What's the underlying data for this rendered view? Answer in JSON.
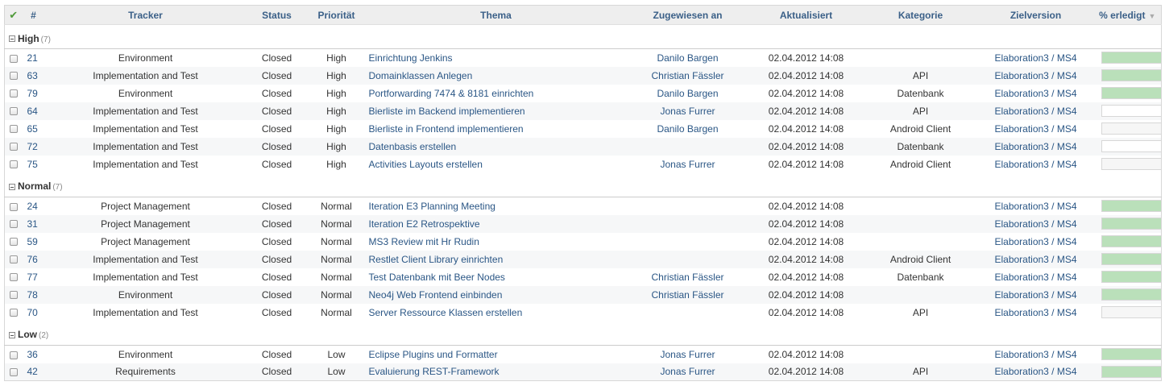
{
  "columns": {
    "id": "#",
    "tracker": "Tracker",
    "status": "Status",
    "priority": "Priorität",
    "subject": "Thema",
    "assigned": "Zugewiesen an",
    "updated": "Aktualisiert",
    "category": "Kategorie",
    "version": "Zielversion",
    "done": "% erledigt"
  },
  "icons": {
    "check_all": "checkmark-icon",
    "sort": "sort-desc-icon",
    "group_toggle": "collapse-icon"
  },
  "colors": {
    "link": "#2a5685",
    "header_bg": "#eeeeee",
    "row_alt": "#f6f7f8",
    "progress_fill": "#bae0ba"
  },
  "groups": [
    {
      "name": "High",
      "count": "(7)",
      "rows": [
        {
          "id": "21",
          "tracker": "Environment",
          "status": "Closed",
          "priority": "High",
          "subject": "Einrichtung Jenkins",
          "assigned": "Danilo Bargen",
          "updated": "02.04.2012 14:08",
          "category": "",
          "version": "Elaboration3 / MS4",
          "done": 1.0
        },
        {
          "id": "63",
          "tracker": "Implementation and Test",
          "status": "Closed",
          "priority": "High",
          "subject": "Domainklassen Anlegen",
          "assigned": "Christian Fässler",
          "updated": "02.04.2012 14:08",
          "category": "API",
          "version": "Elaboration3 / MS4",
          "done": 1.0
        },
        {
          "id": "79",
          "tracker": "Environment",
          "status": "Closed",
          "priority": "High",
          "subject": "Portforwarding 7474 & 8181 einrichten",
          "assigned": "Danilo Bargen",
          "updated": "02.04.2012 14:08",
          "category": "Datenbank",
          "version": "Elaboration3 / MS4",
          "done": 1.0
        },
        {
          "id": "64",
          "tracker": "Implementation and Test",
          "status": "Closed",
          "priority": "High",
          "subject": "Bierliste im Backend implementieren",
          "assigned": "Jonas Furrer",
          "updated": "02.04.2012 14:08",
          "category": "API",
          "version": "Elaboration3 / MS4",
          "done": 0.0
        },
        {
          "id": "65",
          "tracker": "Implementation and Test",
          "status": "Closed",
          "priority": "High",
          "subject": "Bierliste in Frontend implementieren",
          "assigned": "Danilo Bargen",
          "updated": "02.04.2012 14:08",
          "category": "Android Client",
          "version": "Elaboration3 / MS4",
          "done": 0.0
        },
        {
          "id": "72",
          "tracker": "Implementation and Test",
          "status": "Closed",
          "priority": "High",
          "subject": "Datenbasis erstellen",
          "assigned": "",
          "updated": "02.04.2012 14:08",
          "category": "Datenbank",
          "version": "Elaboration3 / MS4",
          "done": 0.0
        },
        {
          "id": "75",
          "tracker": "Implementation and Test",
          "status": "Closed",
          "priority": "High",
          "subject": "Activities Layouts erstellen",
          "assigned": "Jonas Furrer",
          "updated": "02.04.2012 14:08",
          "category": "Android Client",
          "version": "Elaboration3 / MS4",
          "done": 0.0
        }
      ]
    },
    {
      "name": "Normal",
      "count": "(7)",
      "rows": [
        {
          "id": "24",
          "tracker": "Project Management",
          "status": "Closed",
          "priority": "Normal",
          "subject": "Iteration E3 Planning Meeting",
          "assigned": "",
          "updated": "02.04.2012 14:08",
          "category": "",
          "version": "Elaboration3 / MS4",
          "done": 1.0
        },
        {
          "id": "31",
          "tracker": "Project Management",
          "status": "Closed",
          "priority": "Normal",
          "subject": "Iteration E2 Retrospektive",
          "assigned": "",
          "updated": "02.04.2012 14:08",
          "category": "",
          "version": "Elaboration3 / MS4",
          "done": 1.0
        },
        {
          "id": "59",
          "tracker": "Project Management",
          "status": "Closed",
          "priority": "Normal",
          "subject": "MS3 Review mit Hr Rudin",
          "assigned": "",
          "updated": "02.04.2012 14:08",
          "category": "",
          "version": "Elaboration3 / MS4",
          "done": 1.0
        },
        {
          "id": "76",
          "tracker": "Implementation and Test",
          "status": "Closed",
          "priority": "Normal",
          "subject": "Restlet Client Library einrichten",
          "assigned": "",
          "updated": "02.04.2012 14:08",
          "category": "Android Client",
          "version": "Elaboration3 / MS4",
          "done": 1.0
        },
        {
          "id": "77",
          "tracker": "Implementation and Test",
          "status": "Closed",
          "priority": "Normal",
          "subject": "Test Datenbank mit Beer Nodes",
          "assigned": "Christian Fässler",
          "updated": "02.04.2012 14:08",
          "category": "Datenbank",
          "version": "Elaboration3 / MS4",
          "done": 1.0
        },
        {
          "id": "78",
          "tracker": "Environment",
          "status": "Closed",
          "priority": "Normal",
          "subject": "Neo4j Web Frontend einbinden",
          "assigned": "Christian Fässler",
          "updated": "02.04.2012 14:08",
          "category": "",
          "version": "Elaboration3 / MS4",
          "done": 1.0
        },
        {
          "id": "70",
          "tracker": "Implementation and Test",
          "status": "Closed",
          "priority": "Normal",
          "subject": "Server Ressource Klassen erstellen",
          "assigned": "",
          "updated": "02.04.2012 14:08",
          "category": "API",
          "version": "Elaboration3 / MS4",
          "done": 0.0
        }
      ]
    },
    {
      "name": "Low",
      "count": "(2)",
      "rows": [
        {
          "id": "36",
          "tracker": "Environment",
          "status": "Closed",
          "priority": "Low",
          "subject": "Eclipse Plugins und Formatter",
          "assigned": "Jonas Furrer",
          "updated": "02.04.2012 14:08",
          "category": "",
          "version": "Elaboration3 / MS4",
          "done": 1.0
        },
        {
          "id": "42",
          "tracker": "Requirements",
          "status": "Closed",
          "priority": "Low",
          "subject": "Evaluierung REST-Framework",
          "assigned": "Jonas Furrer",
          "updated": "02.04.2012 14:08",
          "category": "API",
          "version": "Elaboration3 / MS4",
          "done": 1.0
        }
      ]
    }
  ]
}
